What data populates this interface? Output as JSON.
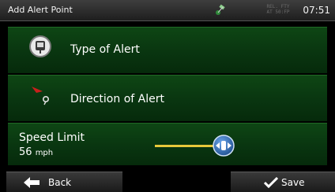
{
  "statusbar": {
    "title": "Add Alert Point",
    "gps_line1": "REL. FTY",
    "gps_line2": "AT 50:FP",
    "time": "07:51"
  },
  "menu": {
    "type_of_alert": "Type of Alert",
    "direction_of_alert": "Direction of Alert",
    "speed_limit_label": "Speed Limit",
    "speed_value": "56",
    "speed_unit": "mph"
  },
  "slider": {
    "level_fraction": 0.5
  },
  "footer": {
    "back_label": "Back",
    "save_label": "Save"
  },
  "colors": {
    "row_green": "#093510",
    "slider_yellow": "#e8c83a",
    "knob_blue": "#1f4f8f"
  },
  "icons": [
    "satellite-icon",
    "alert-type-icon",
    "direction-pin-icon",
    "slider-knob-icon",
    "back-arrow-icon",
    "checkmark-icon"
  ]
}
